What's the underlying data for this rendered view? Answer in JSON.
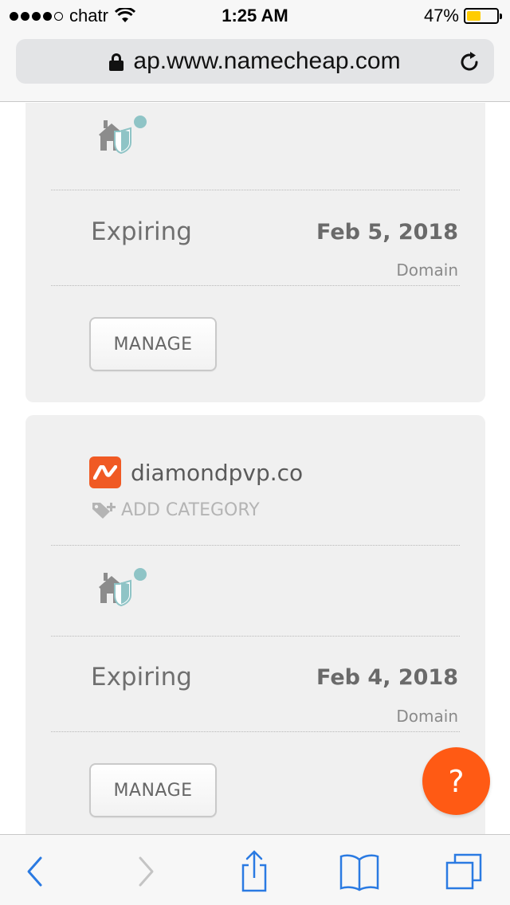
{
  "status_bar": {
    "carrier": "chatr",
    "time": "1:25 AM",
    "battery_percent": "47%",
    "battery_level": 0.47,
    "signal_bars_filled": 4,
    "signal_bars_total": 5
  },
  "browser": {
    "url": "ap.www.namecheap.com"
  },
  "cards": [
    {
      "domain": "",
      "status_label": "Expiring",
      "date": "Feb 5, 2018",
      "type": "Domain",
      "manage_label": "MANAGE"
    },
    {
      "domain": "diamondpvp.co",
      "add_category_label": "ADD CATEGORY",
      "status_label": "Expiring",
      "date": "Feb 4, 2018",
      "type": "Domain",
      "manage_label": "MANAGE"
    }
  ],
  "help_button": {
    "label": "?"
  },
  "colors": {
    "brand_orange": "#f05a24",
    "help_orange": "#ff5a14",
    "ios_blue": "#2a7ae2",
    "card_bg": "#f0f0f0"
  },
  "icons": [
    "lock-icon",
    "reload-icon",
    "shield-house-icon",
    "namecheap-logo-icon",
    "tag-plus-icon",
    "back-icon",
    "forward-icon",
    "share-icon",
    "bookmarks-icon",
    "tabs-icon"
  ]
}
